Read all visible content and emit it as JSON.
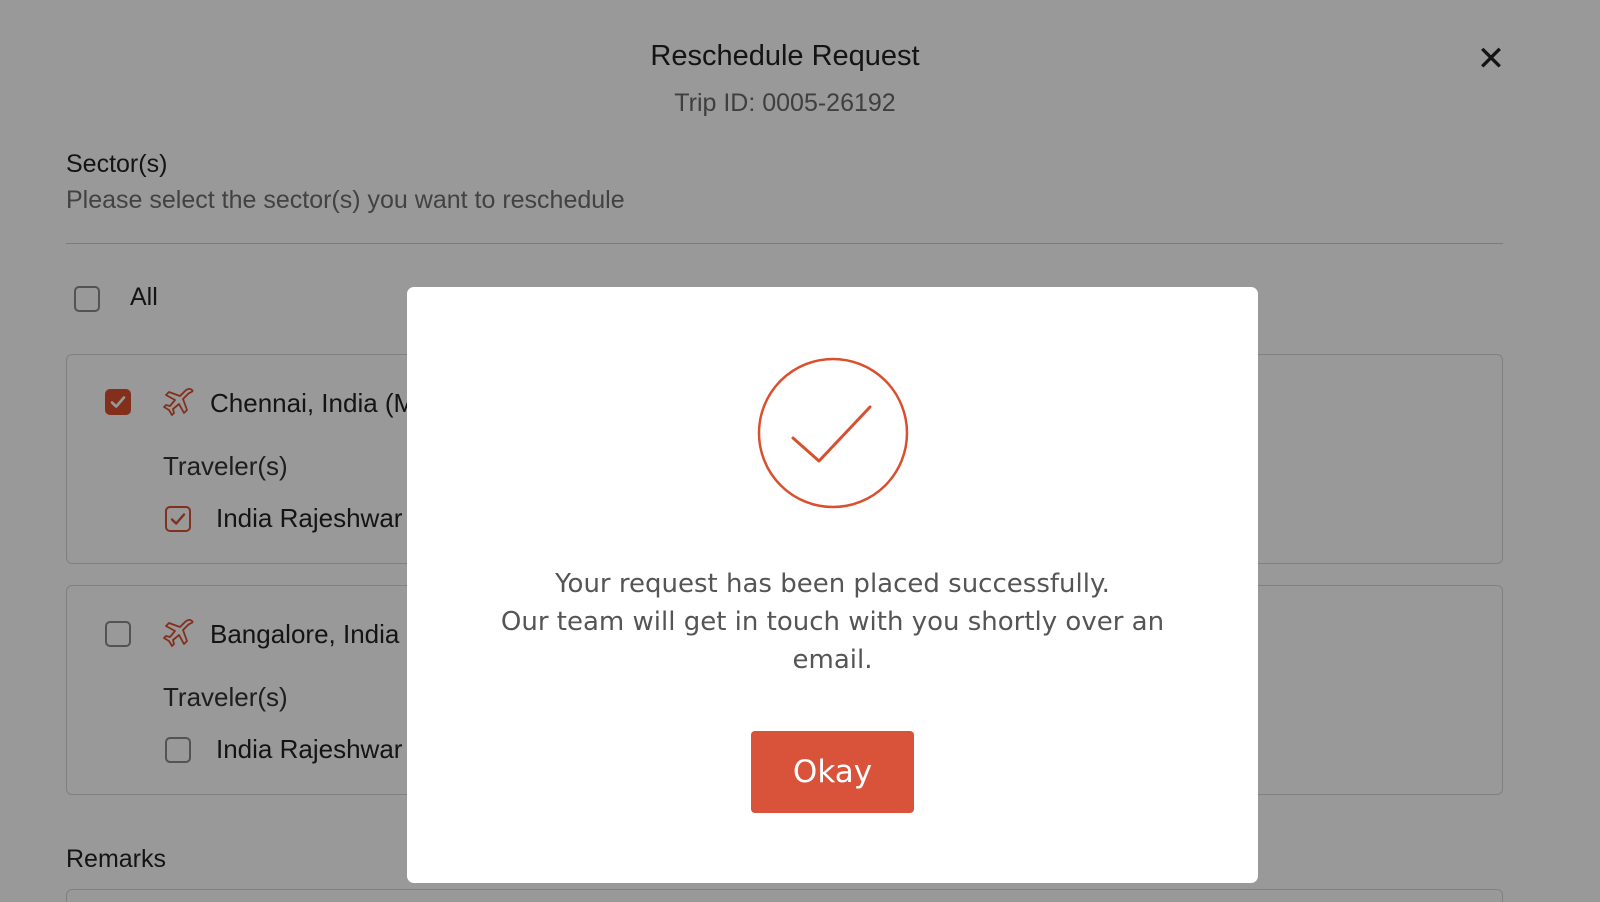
{
  "header": {
    "title": "Reschedule Request",
    "trip_id": "Trip ID: 0005-26192",
    "close_label": "✕"
  },
  "sectors": {
    "label": "Sector(s)",
    "hint": "Please select the sector(s) you want to reschedule",
    "all_label": "All",
    "all_checked": false,
    "items": [
      {
        "name": "Chennai, India (M",
        "checked": true,
        "travelers_label": "Traveler(s)",
        "traveler_name": "India Rajeshwar",
        "traveler_checked": true
      },
      {
        "name": "Bangalore, India",
        "checked": false,
        "travelers_label": "Traveler(s)",
        "traveler_name": "India Rajeshwar",
        "traveler_checked": false
      }
    ]
  },
  "remarks": {
    "label": "Remarks"
  },
  "dialog": {
    "message_line1": "Your request has been placed successfully.",
    "message_line2": "Our team will get in touch with you shortly over an email.",
    "okay_label": "Okay"
  },
  "colors": {
    "accent": "#d9502f",
    "button": "#d9523a",
    "overlay": "rgba(0,0,0,0.40)"
  }
}
